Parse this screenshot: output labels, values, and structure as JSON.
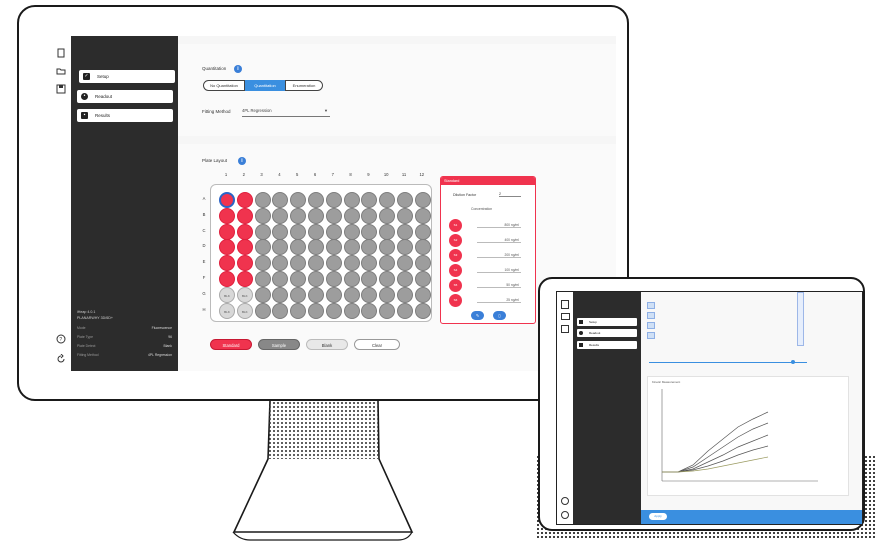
{
  "colors": {
    "accent_red": "#f0334e",
    "accent_blue": "#3a8fe0",
    "sidebar": "#2c2c2c"
  },
  "monitor": {
    "icon_bar": [
      "file-icon",
      "folder-icon",
      "save-icon",
      "help-icon",
      "refresh-icon"
    ],
    "nav": [
      {
        "label": "Setup",
        "icon": "check-icon",
        "active": true
      },
      {
        "label": "Readout",
        "icon": "record-icon",
        "active": false
      },
      {
        "label": "Results",
        "icon": "chart-icon",
        "active": false
      }
    ],
    "sidebar_info": {
      "line1": "iHeap 4.0.1",
      "line2": "PLANARWHY 3D/6D+",
      "rows": [
        {
          "k": "Mode",
          "v": "Fluorescence"
        },
        {
          "k": "Plate Type",
          "v": "96"
        },
        {
          "k": "Plate Detect",
          "v": "Blank"
        },
        {
          "k": "Fitting Method",
          "v": "4PL Regression"
        }
      ]
    },
    "quantitation": {
      "label": "Quantitation",
      "options": [
        "No Quantitation",
        "Quantitation",
        "Enumeration"
      ],
      "selected_index": 1
    },
    "fitting": {
      "label": "Fitting Method",
      "value": "4PL Regression"
    },
    "plate": {
      "label": "Plate Layout",
      "columns": [
        "1",
        "2",
        "3",
        "4",
        "5",
        "6",
        "7",
        "8",
        "9",
        "10",
        "11",
        "12"
      ],
      "rows": [
        "A",
        "B",
        "C",
        "D",
        "E",
        "F",
        "G",
        "H"
      ],
      "blank_label": "BLK"
    },
    "buttons": {
      "standard": "Standard",
      "sample": "Sample",
      "blank": "Blank",
      "clear": "Clear"
    },
    "standards": {
      "title": "Standard",
      "dilution_label": "Dilution Factor",
      "dilution_value": "2",
      "unit_label": "Concentration",
      "entries": [
        {
          "id": "S1",
          "value": "800 ng/ml"
        },
        {
          "id": "S2",
          "value": "400 ng/ml"
        },
        {
          "id": "S3",
          "value": "200 ng/ml"
        },
        {
          "id": "S4",
          "value": "100 ng/ml"
        },
        {
          "id": "S5",
          "value": "50 ng/ml"
        },
        {
          "id": "S6",
          "value": "25 ng/ml"
        }
      ]
    }
  },
  "tablet": {
    "nav": [
      "Setup",
      "Readout",
      "Results"
    ],
    "chart_title": "Kinetic Measurement",
    "apply_label": "Apply"
  }
}
